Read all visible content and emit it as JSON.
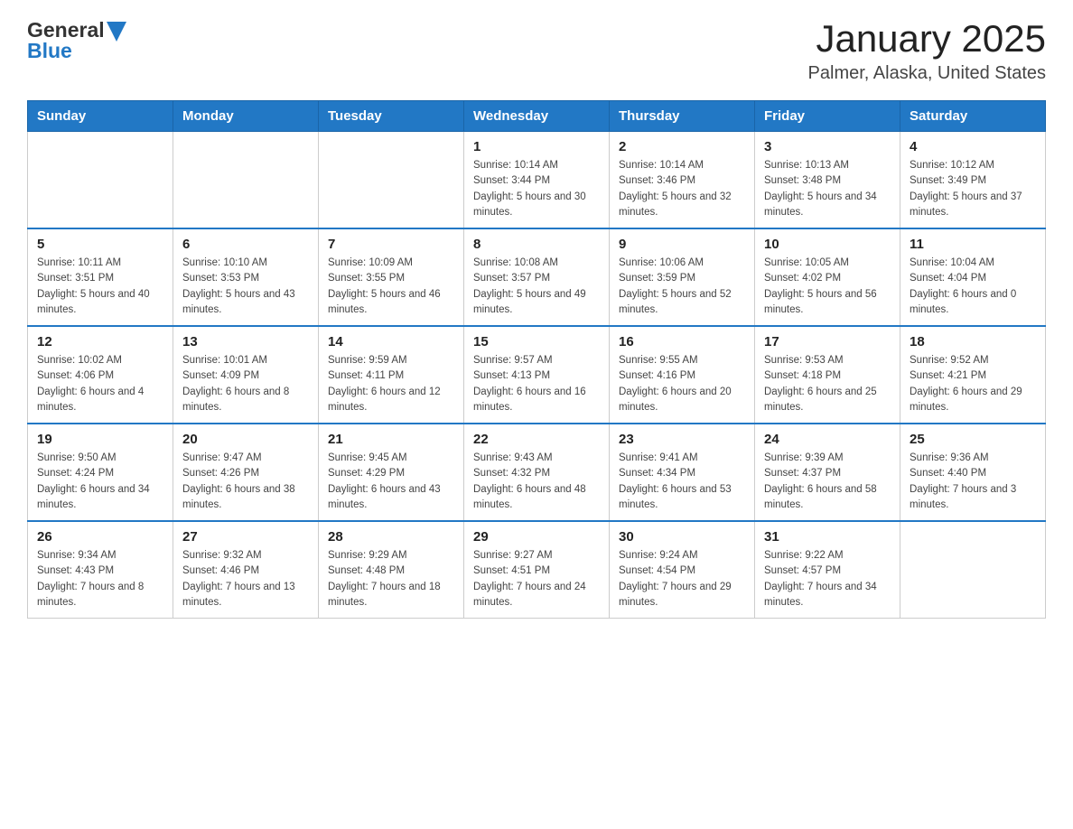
{
  "header": {
    "month": "January 2025",
    "location": "Palmer, Alaska, United States",
    "logo_general": "General",
    "logo_blue": "Blue"
  },
  "days_of_week": [
    "Sunday",
    "Monday",
    "Tuesday",
    "Wednesday",
    "Thursday",
    "Friday",
    "Saturday"
  ],
  "weeks": [
    [
      {
        "day": "",
        "sunrise": "",
        "sunset": "",
        "daylight": ""
      },
      {
        "day": "",
        "sunrise": "",
        "sunset": "",
        "daylight": ""
      },
      {
        "day": "",
        "sunrise": "",
        "sunset": "",
        "daylight": ""
      },
      {
        "day": "1",
        "sunrise": "Sunrise: 10:14 AM",
        "sunset": "Sunset: 3:44 PM",
        "daylight": "Daylight: 5 hours and 30 minutes."
      },
      {
        "day": "2",
        "sunrise": "Sunrise: 10:14 AM",
        "sunset": "Sunset: 3:46 PM",
        "daylight": "Daylight: 5 hours and 32 minutes."
      },
      {
        "day": "3",
        "sunrise": "Sunrise: 10:13 AM",
        "sunset": "Sunset: 3:48 PM",
        "daylight": "Daylight: 5 hours and 34 minutes."
      },
      {
        "day": "4",
        "sunrise": "Sunrise: 10:12 AM",
        "sunset": "Sunset: 3:49 PM",
        "daylight": "Daylight: 5 hours and 37 minutes."
      }
    ],
    [
      {
        "day": "5",
        "sunrise": "Sunrise: 10:11 AM",
        "sunset": "Sunset: 3:51 PM",
        "daylight": "Daylight: 5 hours and 40 minutes."
      },
      {
        "day": "6",
        "sunrise": "Sunrise: 10:10 AM",
        "sunset": "Sunset: 3:53 PM",
        "daylight": "Daylight: 5 hours and 43 minutes."
      },
      {
        "day": "7",
        "sunrise": "Sunrise: 10:09 AM",
        "sunset": "Sunset: 3:55 PM",
        "daylight": "Daylight: 5 hours and 46 minutes."
      },
      {
        "day": "8",
        "sunrise": "Sunrise: 10:08 AM",
        "sunset": "Sunset: 3:57 PM",
        "daylight": "Daylight: 5 hours and 49 minutes."
      },
      {
        "day": "9",
        "sunrise": "Sunrise: 10:06 AM",
        "sunset": "Sunset: 3:59 PM",
        "daylight": "Daylight: 5 hours and 52 minutes."
      },
      {
        "day": "10",
        "sunrise": "Sunrise: 10:05 AM",
        "sunset": "Sunset: 4:02 PM",
        "daylight": "Daylight: 5 hours and 56 minutes."
      },
      {
        "day": "11",
        "sunrise": "Sunrise: 10:04 AM",
        "sunset": "Sunset: 4:04 PM",
        "daylight": "Daylight: 6 hours and 0 minutes."
      }
    ],
    [
      {
        "day": "12",
        "sunrise": "Sunrise: 10:02 AM",
        "sunset": "Sunset: 4:06 PM",
        "daylight": "Daylight: 6 hours and 4 minutes."
      },
      {
        "day": "13",
        "sunrise": "Sunrise: 10:01 AM",
        "sunset": "Sunset: 4:09 PM",
        "daylight": "Daylight: 6 hours and 8 minutes."
      },
      {
        "day": "14",
        "sunrise": "Sunrise: 9:59 AM",
        "sunset": "Sunset: 4:11 PM",
        "daylight": "Daylight: 6 hours and 12 minutes."
      },
      {
        "day": "15",
        "sunrise": "Sunrise: 9:57 AM",
        "sunset": "Sunset: 4:13 PM",
        "daylight": "Daylight: 6 hours and 16 minutes."
      },
      {
        "day": "16",
        "sunrise": "Sunrise: 9:55 AM",
        "sunset": "Sunset: 4:16 PM",
        "daylight": "Daylight: 6 hours and 20 minutes."
      },
      {
        "day": "17",
        "sunrise": "Sunrise: 9:53 AM",
        "sunset": "Sunset: 4:18 PM",
        "daylight": "Daylight: 6 hours and 25 minutes."
      },
      {
        "day": "18",
        "sunrise": "Sunrise: 9:52 AM",
        "sunset": "Sunset: 4:21 PM",
        "daylight": "Daylight: 6 hours and 29 minutes."
      }
    ],
    [
      {
        "day": "19",
        "sunrise": "Sunrise: 9:50 AM",
        "sunset": "Sunset: 4:24 PM",
        "daylight": "Daylight: 6 hours and 34 minutes."
      },
      {
        "day": "20",
        "sunrise": "Sunrise: 9:47 AM",
        "sunset": "Sunset: 4:26 PM",
        "daylight": "Daylight: 6 hours and 38 minutes."
      },
      {
        "day": "21",
        "sunrise": "Sunrise: 9:45 AM",
        "sunset": "Sunset: 4:29 PM",
        "daylight": "Daylight: 6 hours and 43 minutes."
      },
      {
        "day": "22",
        "sunrise": "Sunrise: 9:43 AM",
        "sunset": "Sunset: 4:32 PM",
        "daylight": "Daylight: 6 hours and 48 minutes."
      },
      {
        "day": "23",
        "sunrise": "Sunrise: 9:41 AM",
        "sunset": "Sunset: 4:34 PM",
        "daylight": "Daylight: 6 hours and 53 minutes."
      },
      {
        "day": "24",
        "sunrise": "Sunrise: 9:39 AM",
        "sunset": "Sunset: 4:37 PM",
        "daylight": "Daylight: 6 hours and 58 minutes."
      },
      {
        "day": "25",
        "sunrise": "Sunrise: 9:36 AM",
        "sunset": "Sunset: 4:40 PM",
        "daylight": "Daylight: 7 hours and 3 minutes."
      }
    ],
    [
      {
        "day": "26",
        "sunrise": "Sunrise: 9:34 AM",
        "sunset": "Sunset: 4:43 PM",
        "daylight": "Daylight: 7 hours and 8 minutes."
      },
      {
        "day": "27",
        "sunrise": "Sunrise: 9:32 AM",
        "sunset": "Sunset: 4:46 PM",
        "daylight": "Daylight: 7 hours and 13 minutes."
      },
      {
        "day": "28",
        "sunrise": "Sunrise: 9:29 AM",
        "sunset": "Sunset: 4:48 PM",
        "daylight": "Daylight: 7 hours and 18 minutes."
      },
      {
        "day": "29",
        "sunrise": "Sunrise: 9:27 AM",
        "sunset": "Sunset: 4:51 PM",
        "daylight": "Daylight: 7 hours and 24 minutes."
      },
      {
        "day": "30",
        "sunrise": "Sunrise: 9:24 AM",
        "sunset": "Sunset: 4:54 PM",
        "daylight": "Daylight: 7 hours and 29 minutes."
      },
      {
        "day": "31",
        "sunrise": "Sunrise: 9:22 AM",
        "sunset": "Sunset: 4:57 PM",
        "daylight": "Daylight: 7 hours and 34 minutes."
      },
      {
        "day": "",
        "sunrise": "",
        "sunset": "",
        "daylight": ""
      }
    ]
  ]
}
